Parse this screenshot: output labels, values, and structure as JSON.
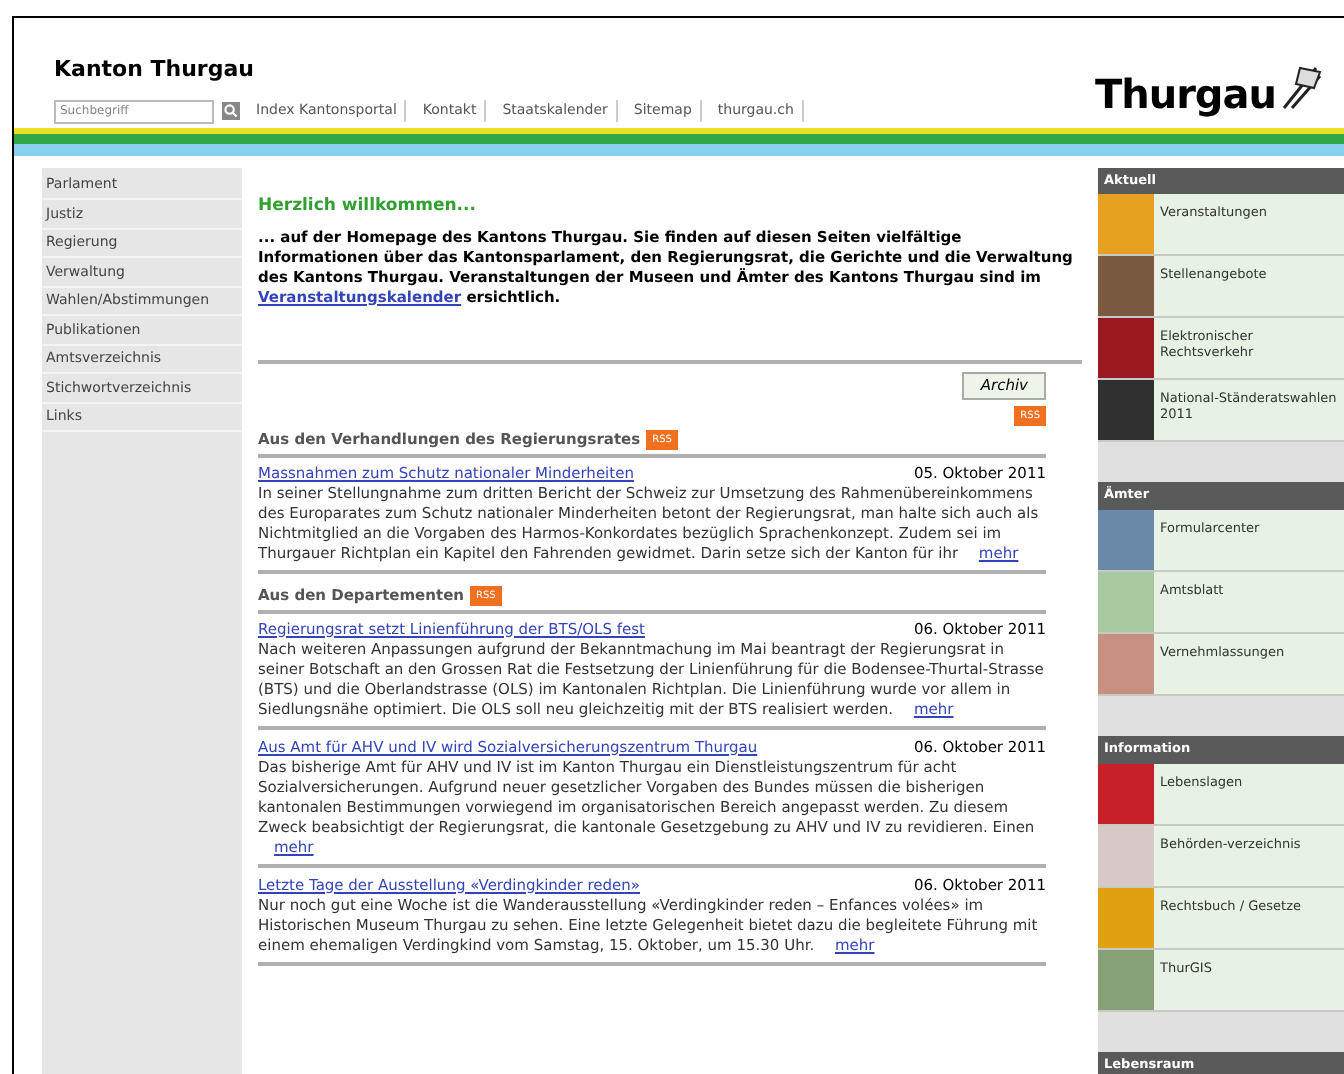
{
  "header": {
    "title": "Kanton Thurgau",
    "search": {
      "placeholder": "Suchbegriff"
    },
    "nav": [
      "Index Kantonsportal",
      "Kontakt",
      "Staatskalender",
      "Sitemap",
      "thurgau.ch"
    ],
    "logo": "Thurgau"
  },
  "sidebar": {
    "items": [
      "Parlament",
      "Justiz",
      "Regierung",
      "Verwaltung",
      "Wahlen/Abstimmungen",
      "Publikationen",
      "Amtsverzeichnis",
      "Stichwortverzeichnis",
      "Links"
    ]
  },
  "main": {
    "welcome": "Herzlich willkommen...",
    "intro": "... auf der Homepage des Kantons Thurgau. Sie finden auf diesen Seiten vielfältige Informationen über das Kantonsparlament, den Regierungsrat, die Gerichte und die Verwaltung des Kantons Thurgau. Veranstaltungen der Museen und Ämter des Kantons Thurgau sind im",
    "intro_link": "Veranstaltungskalender",
    "intro_end": "ersichtlich.",
    "archive_button": "Archiv",
    "rss": "RSS",
    "sections": [
      {
        "title": "Aus den Verhandlungen des Regierungsrates",
        "rss": "RSS",
        "items": [
          {
            "title": "Massnahmen zum Schutz nationaler Minderheiten",
            "date": "05. Oktober 2011",
            "text": "In seiner Stellungnahme zum dritten Bericht der Schweiz zur Umsetzung des Rahmenübereinkommens des Europarates zum Schutz nationaler Minderheiten betont der Regierungsrat, man halte sich auch als Nichtmitglied an die Vorgaben des Harmos-Konkordates bezüglich Sprachenkonzept. Zudem sei im Thurgauer Richtplan ein Kapitel den Fahrenden gewidmet. Darin setze sich der Kanton für ihr",
            "more": "mehr"
          }
        ]
      },
      {
        "title": "Aus den Departementen",
        "rss": "RSS",
        "items": [
          {
            "title": "Regierungsrat setzt Linienführung der BTS/OLS fest",
            "date": "06. Oktober 2011",
            "text": "Nach weiteren Anpassungen aufgrund der Bekanntmachung im Mai beantragt der Regierungsrat in seiner Botschaft an den Grossen Rat die Festsetzung der Linienführung für die Bodensee-Thurtal-Strasse (BTS) und die Oberlandstrasse (OLS) im Kantonalen Richtplan. Die Linienführung wurde vor allem in Siedlungsnähe optimiert. Die OLS soll neu gleichzeitig mit der BTS realisiert werden.",
            "more": "mehr"
          },
          {
            "title": "Aus Amt für AHV und IV wird Sozialversicherungszentrum Thurgau",
            "date": "06. Oktober 2011",
            "text": "Das bisherige Amt für AHV und IV ist im Kanton Thurgau ein Dienstleistungszentrum für acht Sozialversicherungen. Aufgrund neuer gesetzlicher Vorgaben des Bundes müssen die bisherigen kantonalen Bestimmungen vorwiegend im organisatorischen Bereich angepasst werden. Zu diesem Zweck beabsichtigt der Regierungsrat, die kantonale Gesetzgebung zu AHV und IV zu revidieren. Einen",
            "more": "mehr"
          },
          {
            "title": "Letzte Tage der Ausstellung «Verdingkinder reden»",
            "date": "06. Oktober 2011",
            "text": "Nur noch gut eine Woche ist die Wanderausstellung «Verdingkinder reden – Enfances volées» im Historischen Museum Thurgau zu sehen. Eine letzte Gelegenheit bietet dazu die begleitete Führung mit einem ehemaligen Verdingkind vom Samstag, 15. Oktober, um 15.30 Uhr.",
            "more": "mehr"
          }
        ]
      }
    ]
  },
  "right": {
    "sections": [
      {
        "title": "Aktuell",
        "items": [
          {
            "label": "Veranstaltungen",
            "color": "#e8a020"
          },
          {
            "label": "Stellenangebote",
            "color": "#7a5a40"
          },
          {
            "label": "Elektronischer Rechtsverkehr",
            "color": "#9a1a20"
          },
          {
            "label": "National-Ständeratswahlen 2011",
            "color": "#303030"
          }
        ]
      },
      {
        "title": "Ämter",
        "items": [
          {
            "label": "Formularcenter",
            "color": "#6a88a8"
          },
          {
            "label": "Amtsblatt",
            "color": "#a8c8a0"
          },
          {
            "label": "Vernehmlassungen",
            "color": "#c89080"
          }
        ]
      },
      {
        "title": "Information",
        "items": [
          {
            "label": "Lebenslagen",
            "color": "#c82028"
          },
          {
            "label": "Behörden-verzeichnis",
            "color": "#d8c8c8"
          },
          {
            "label": "Rechtsbuch / Gesetze",
            "color": "#e0a010"
          },
          {
            "label": "ThurGIS",
            "color": "#88a078"
          }
        ]
      },
      {
        "title": "Lebensraum"
      }
    ]
  }
}
